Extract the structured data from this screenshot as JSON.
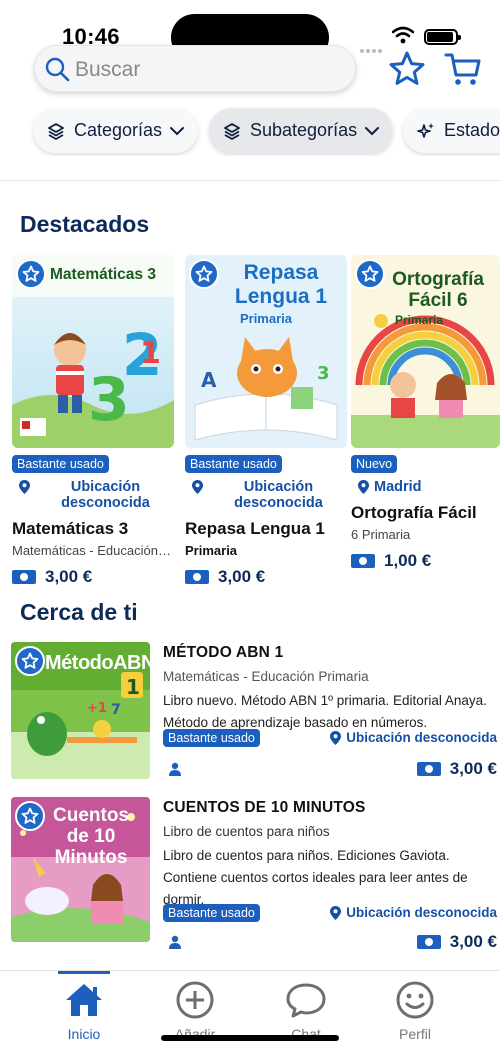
{
  "status_bar": {
    "time": "10:46"
  },
  "search": {
    "placeholder": "Buscar"
  },
  "header_icons": {
    "favorites": "star-icon",
    "cart": "cart-icon"
  },
  "filters": [
    {
      "label": "Categorías",
      "icon": "layers-icon"
    },
    {
      "label": "Subategorías",
      "icon": "layers-icon"
    },
    {
      "label": "Estado",
      "icon": "sparkles-icon"
    }
  ],
  "featured": {
    "title": "Destacados",
    "items": [
      {
        "cover_title": "Matemáticas 3",
        "cover_subtitle": "",
        "condition": "Bastante usado",
        "location": "Ubicación desconocida",
        "title": "Matemáticas 3",
        "subtitle": "Matemáticas - Educación Primaria",
        "price": "3,00 €"
      },
      {
        "cover_title": "Repasa Lengua 1",
        "cover_subtitle": "Primaria",
        "condition": "Bastante usado",
        "location": "Ubicación desconocida",
        "title": "Repasa Lengua 1",
        "subtitle": "Primaria",
        "price": "3,00 €"
      },
      {
        "cover_title": "Ortografía Fácil 6",
        "cover_subtitle": "Primaria",
        "condition": "Nuevo",
        "location": "Madrid",
        "title": "Ortografía Fácil",
        "subtitle": "6 Primaria",
        "price": "1,00 €"
      }
    ]
  },
  "nearby": {
    "title": "Cerca de ti",
    "items": [
      {
        "cover_title": "MétodoABN 1",
        "title": "MÉTODO ABN 1",
        "category": "Matemáticas - Educación Primaria",
        "description": "Libro nuevo. Método ABN 1º primaria. Editorial Anaya. Método de aprendizaje basado en números.",
        "condition": "Bastante usado",
        "location": "Ubicación desconocida",
        "price": "3,00 €"
      },
      {
        "cover_title": "Cuentos de 10 Minutos",
        "title": "CUENTOS DE 10 MINUTOS",
        "category": "Libro de cuentos para niños",
        "description": "Libro de cuentos para niños. Ediciones Gaviota. Contiene cuentos cortos ideales para leer antes de dormir.",
        "condition": "Bastante usado",
        "location": "Ubicación desconocida",
        "price": "3,00 €"
      }
    ]
  },
  "tabs": [
    {
      "label": "Inicio",
      "icon": "home-icon",
      "active": true
    },
    {
      "label": "Añadir",
      "icon": "add-circle-icon",
      "active": false
    },
    {
      "label": "Chat",
      "icon": "chat-icon",
      "active": false
    },
    {
      "label": "Perfil",
      "icon": "smiley-icon",
      "active": false
    }
  ],
  "colors": {
    "accent": "#1d5fbd",
    "heading": "#0e2a58",
    "badge": "#1d5fbd"
  }
}
